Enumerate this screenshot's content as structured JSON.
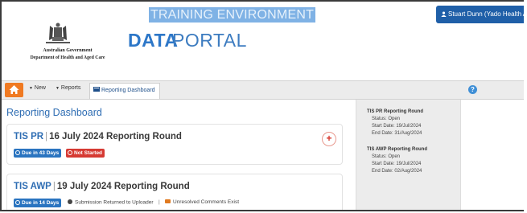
{
  "header": {
    "environment_banner": "TRAINING ENVIRONMENT",
    "user_button": "Stuart Dunn (Yado Health Al",
    "gov_name": "Australian Government",
    "dept_name": "Department of Health and Aged Care",
    "logo_bold": "DATA",
    "logo_light": "PORTAL"
  },
  "nav": {
    "home_icon": "home-icon",
    "new_label": "New",
    "reports_label": "Reports",
    "dashboard_tab": "Reporting Dashboard",
    "help_label": "?"
  },
  "main": {
    "title": "Reporting Dashboard",
    "cards": [
      {
        "code": "TIS PR",
        "separator": "|",
        "name": "16 July 2024 Reporting Round",
        "due_badge": "Due in 43 Days",
        "status_badge": "Not Started",
        "add_button": "+"
      },
      {
        "code": "TIS AWP",
        "separator": "|",
        "name": "19 July 2024 Reporting Round",
        "due_badge": "Due in 14 Days",
        "status_text": "Submission Returned to Uploader",
        "divider": "|",
        "comments_text": "Unresolved Comments Exist"
      }
    ]
  },
  "side_panel": {
    "rounds": [
      {
        "title": "TIS PR Reporting Round",
        "status": "Status: Open",
        "start": "Start Date: 19/Jul/2024",
        "end": "End Date: 31/Aug/2024"
      },
      {
        "title": "TIS AWP Reporting Round",
        "status": "Status: Open",
        "start": "Start Date: 19/Jul/2024",
        "end": "End Date: 02/Aug/2024"
      }
    ]
  },
  "colors": {
    "brand_blue": "#2e6db3",
    "banner_blue": "#7fb2e5",
    "home_orange": "#f07a22",
    "due_blue": "#2a74c0",
    "not_started_red": "#d63a33"
  }
}
